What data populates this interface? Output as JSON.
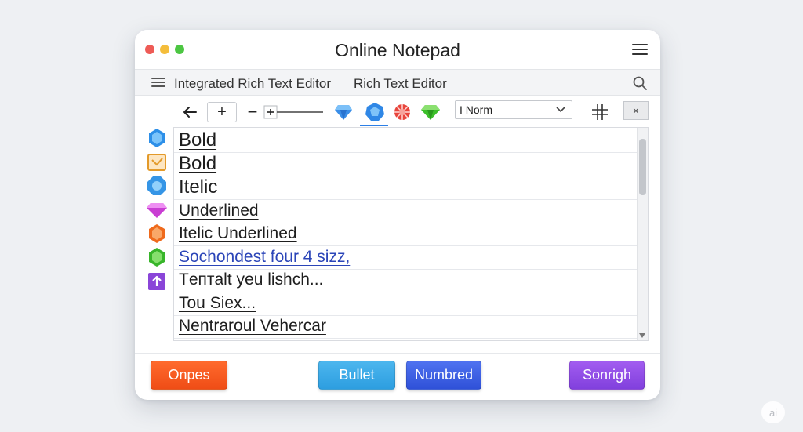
{
  "window": {
    "title": "Online Notepad"
  },
  "subbar": {
    "tabs": [
      {
        "label": "Integrated Rich Text Editor"
      },
      {
        "label": "Rich Text Editor"
      }
    ]
  },
  "toolbar": {
    "plus_label": "+",
    "minus_label": "−",
    "style_select_value": "I Norm",
    "close_label": "×"
  },
  "icons": {
    "back": "arrow-left-icon",
    "slider": "slider-icon",
    "gems": [
      "blue-diamond-icon",
      "blue-gem-icon",
      "red-orb-icon",
      "green-diamond-icon"
    ],
    "side": [
      "blue-hexagon-icon",
      "check-box-icon",
      "blue-octagon-icon",
      "pink-diamond-icon",
      "orange-hexagon-icon",
      "green-hexagon-icon",
      "upload-arrow-icon"
    ]
  },
  "editor": {
    "lines": [
      {
        "text": "Bold"
      },
      {
        "text": "Bold"
      },
      {
        "text": "Itelic"
      },
      {
        "text": "Underlined"
      },
      {
        "text": "Itelic Underlined"
      },
      {
        "text": "Sochondest four 4 sizz,"
      },
      {
        "text": "Tептalt yeu lishch..."
      },
      {
        "text": "Tou Siex..."
      },
      {
        "text": "Nentraroul Vehercar"
      }
    ]
  },
  "footer": {
    "buttons": [
      {
        "label": "Onpes"
      },
      {
        "label": "Bullet"
      },
      {
        "label": "Numbred"
      },
      {
        "label": "Sonrigh"
      }
    ]
  },
  "badge": {
    "label": "ai"
  },
  "colors": {
    "background": "#eef0f3",
    "orange_button": "#ef4d16",
    "bullet_button": "#2d9ee0",
    "numbered_button": "#2f51d8",
    "purple_button": "#8140dd",
    "link_text": "#2b45b8"
  }
}
